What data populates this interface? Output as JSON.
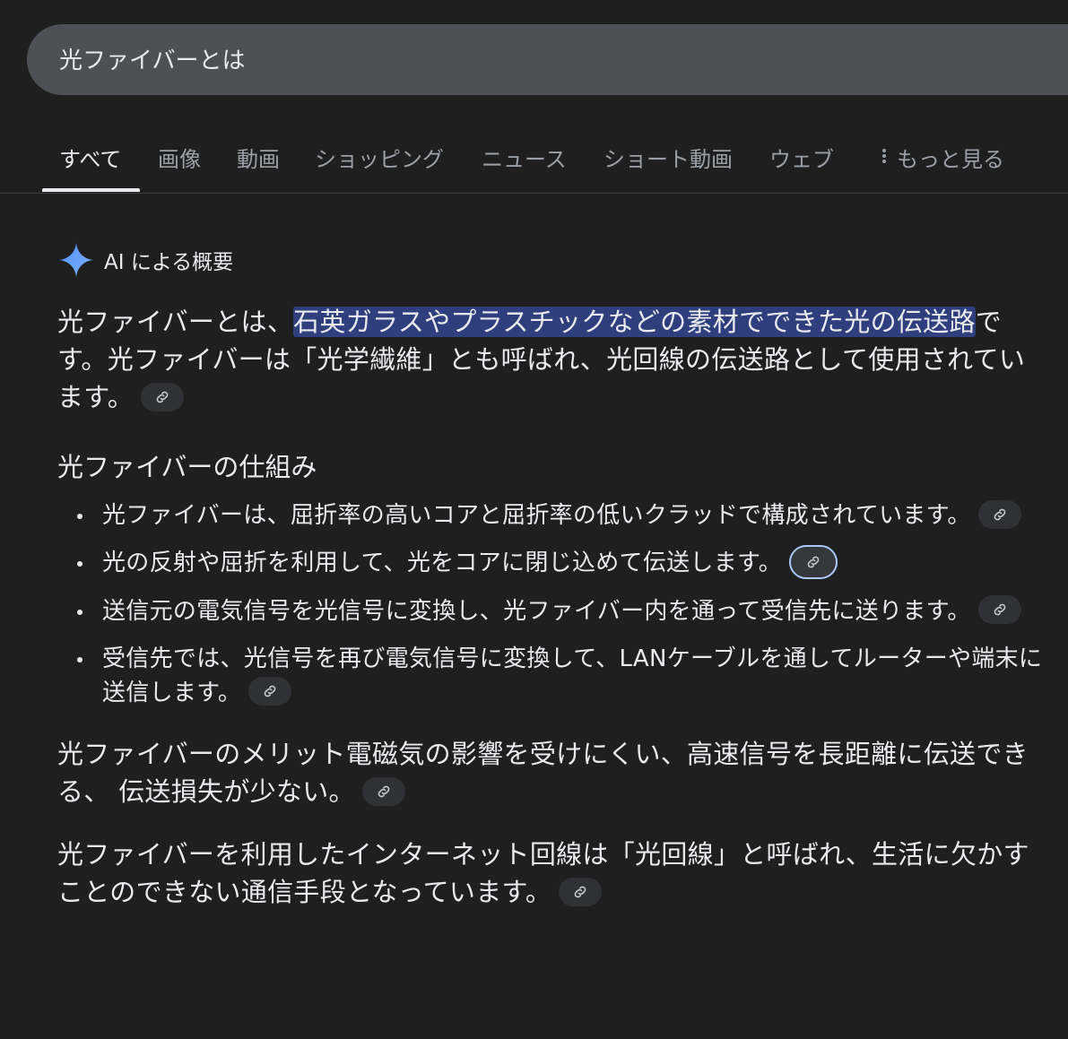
{
  "search": {
    "query": "光ファイバーとは"
  },
  "tabs": [
    {
      "label": "すべて"
    },
    {
      "label": "画像"
    },
    {
      "label": "動画"
    },
    {
      "label": "ショッピング"
    },
    {
      "label": "ニュース"
    },
    {
      "label": "ショート動画"
    },
    {
      "label": "ウェブ"
    },
    {
      "label": "もっと見る"
    }
  ],
  "ai_overview": {
    "label": "AI による概要",
    "intro": {
      "before": "光ファイバーとは、",
      "highlight": "石英ガラスやプラスチックなどの素材でできた光の伝送路",
      "after": "です。光ファイバーは「光学繊維」とも呼ばれ、光回線の伝送路として使用されています。"
    },
    "mechanism_heading": "光ファイバーの仕組み",
    "bullets": [
      "光ファイバーは、屈折率の高いコアと屈折率の低いクラッドで構成されています。",
      "光の反射や屈折を利用して、光をコアに閉じ込めて伝送します。",
      "送信元の電気信号を光信号に変換し、光ファイバー内を通って受信先に送ります。",
      "受信先では、光信号を再び電気信号に変換して、LANケーブルを通してルーターや端末に送信します。"
    ],
    "merits": "光ファイバーのメリット電磁気の影響を受けにくい、高速信号を長距離に伝送できる、 伝送損失が少ない。",
    "internet": "光ファイバーを利用したインターネット回線は「光回線」と呼ばれ、生活に欠かすことのできない通信手段となっています。"
  },
  "colors": {
    "background": "#1f1f1f",
    "highlight": "#2f3f7d",
    "gemini_star": "#4c8df6"
  }
}
